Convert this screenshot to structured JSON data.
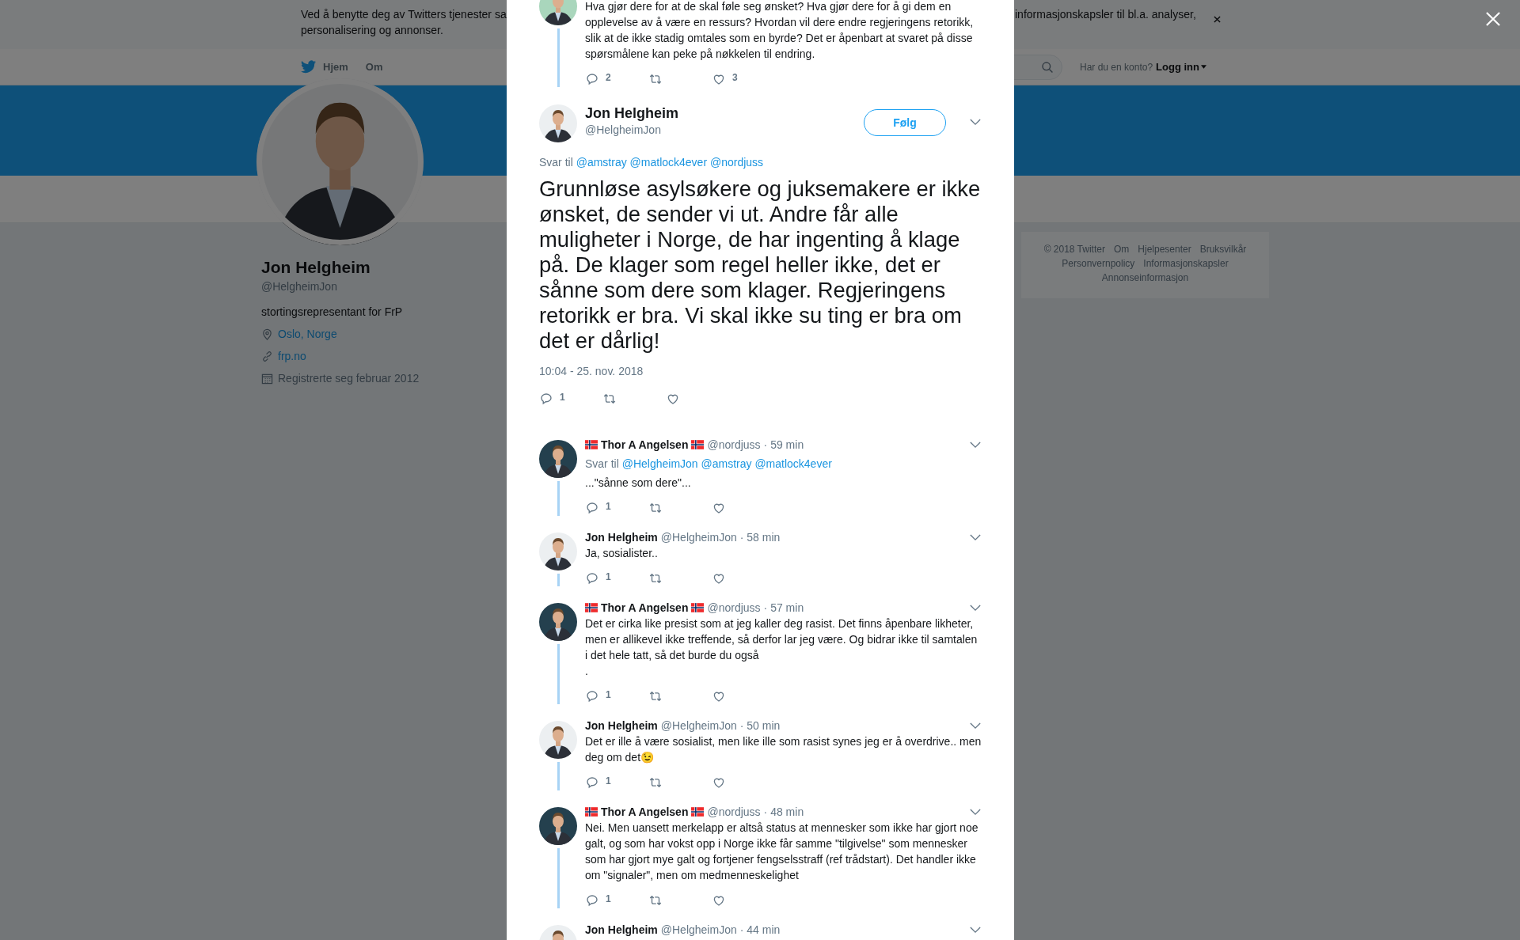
{
  "cookie_banner": {
    "lines": [
      "Ved å benytte deg av Twitters tjenester sa",
      "personalisering og annonser."
    ],
    "text_right": "informasjonskapsler til bl.a. analyser,"
  },
  "nav": {
    "links": [
      "Hjem",
      "Om"
    ],
    "account_prompt": "Har du en konto?",
    "login": "Logg inn"
  },
  "profile": {
    "name": "Jon Helgheim",
    "handle": "@HelgheimJon",
    "bio": "stortingsrepresentant for FrP",
    "details": [
      {
        "kind": "location",
        "text": "Oslo, Norge"
      },
      {
        "kind": "url",
        "text": "frp.no"
      },
      {
        "kind": "joined",
        "text": "Registrerte seg februar 2012"
      }
    ]
  },
  "footer_links": [
    "© 2018 Twitter",
    "Om",
    "Hjelpesenter",
    "Bruksvilkår",
    "Personvernpolicy",
    "Informasjonskapsler",
    "Annonseinformasjon"
  ],
  "dialog": {
    "tweets": [
      {
        "kind": "partial",
        "thread_line": true,
        "text": "Hva gjør dere for at de skal føle seg ønsket? Hva gjør dere for å gi dem en opplevelse av å være en ressurs? Hvordan vil dere endre regjeringens retorikk, slik at de ikke stadig omtales som en byrde? Det er åpenbart at svaret på disse spørsmålene kan peke på nøkkelen til endring.",
        "replies": "2",
        "likes": "3"
      },
      {
        "kind": "main",
        "author": "Jon Helgheim",
        "handle": "@HelgheimJon",
        "follow": "Følg",
        "reply_to": {
          "label": "Svar til",
          "handles": [
            "@amstray",
            "@matlock4ever",
            "@nordjuss"
          ]
        },
        "text": "Grunnløse asylsøkere og juksemakere er ikke ønsket, de sender vi ut. Andre får alle muligheter i Norge, de har ingenting å klage på. De klager som regel heller ikke, det er sånne som dere som klager. Regjeringens retorikk er bra. Vi skal ikke su ting er bra om det er dårlig!",
        "time": "10:04 - 25. nov. 2018",
        "replies": "1"
      },
      {
        "kind": "reply",
        "flags": true,
        "thread_line": true,
        "author": "Thor A Angelsen",
        "handle": "@nordjuss",
        "time": "· 59 min",
        "reply_to": {
          "label": "Svar til",
          "handles": [
            "@HelgheimJon",
            "@amstray",
            "@matlock4ever"
          ]
        },
        "text": "...\"sånne som dere\"...",
        "replies": "1"
      },
      {
        "kind": "reply",
        "flags": false,
        "thread_line": true,
        "author": "Jon Helgheim",
        "handle": "@HelgheimJon",
        "time": "· 58 min",
        "text": "Ja, sosialister..",
        "replies": "1"
      },
      {
        "kind": "reply",
        "flags": true,
        "thread_line": true,
        "author": "Thor A Angelsen",
        "handle": "@nordjuss",
        "time": "· 57 min",
        "text": "Det er cirka like presist som at jeg kaller deg rasist. Det finns åpenbare likheter, men er allikevel ikke treffende, så derfor lar jeg være. Og bidrar ikke til samtalen i det hele tatt, så det burde du også\n.",
        "replies": "1"
      },
      {
        "kind": "reply",
        "flags": false,
        "thread_line": true,
        "author": "Jon Helgheim",
        "handle": "@HelgheimJon",
        "time": "· 50 min",
        "text": "Det er ille å være sosialist, men like ille som rasist synes jeg er å overdrive.. men deg om det😉",
        "replies": "1"
      },
      {
        "kind": "reply",
        "flags": true,
        "thread_line": true,
        "author": "Thor A Angelsen",
        "handle": "@nordjuss",
        "time": "· 48 min",
        "text": "Nei. Men uansett merkelapp er altså status at mennesker som ikke har gjort noe galt, og som har vokst opp i Norge ikke får samme \"tilgivelse\" som mennesker som har gjort mye galt og fortjener fengselsstraff (ref trådstart). Det handler ikke om \"signaler\", men om medmenneskelighet",
        "replies": "1"
      },
      {
        "kind": "reply",
        "flags": false,
        "thread_line": false,
        "author": "Jon Helgheim",
        "handle": "@HelgheimJon",
        "time": "· 44 min"
      }
    ]
  }
}
